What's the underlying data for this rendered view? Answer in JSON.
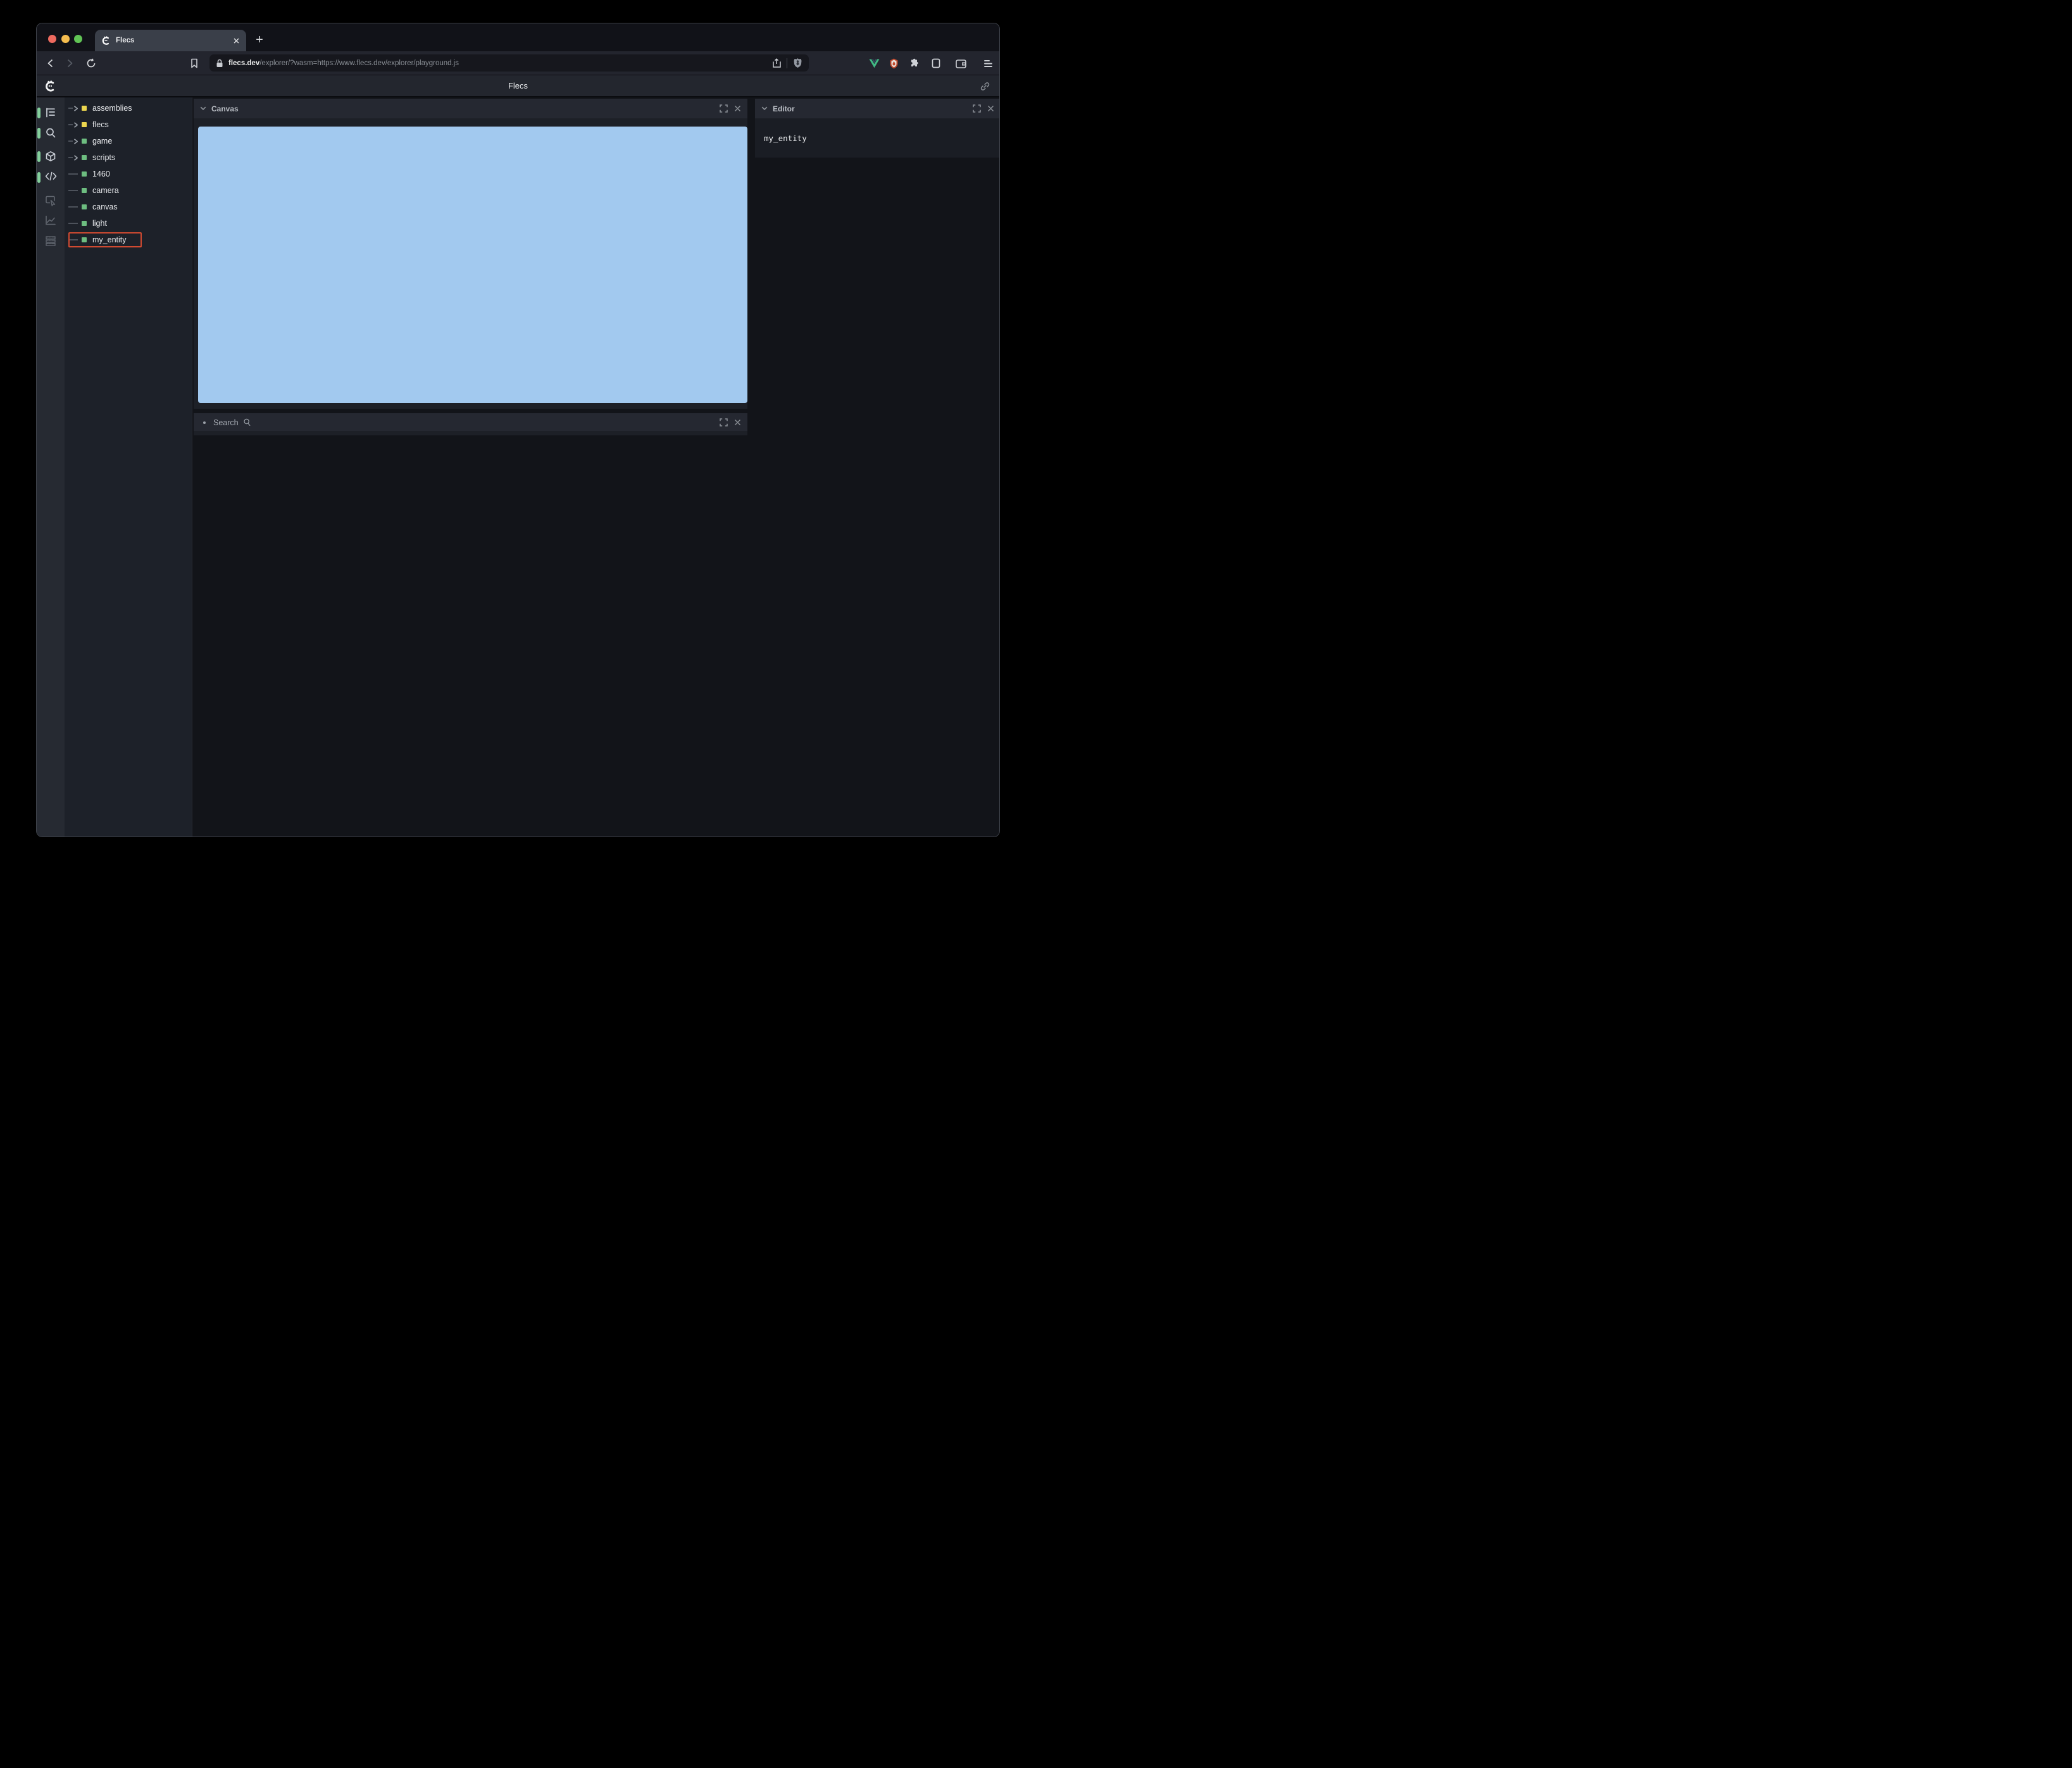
{
  "browser": {
    "tab": {
      "title": "Flecs",
      "close_label": "×",
      "favicon": "flecs-logo"
    },
    "new_tab_label": "+",
    "address": {
      "domain": "flecs.dev",
      "path": "/explorer/?wasm=https://www.flecs.dev/explorer/playground.js"
    },
    "toolbar_icons": [
      "back",
      "forward",
      "reload",
      "bookmark",
      "lock",
      "share",
      "brave-lion",
      "vue-devtools",
      "shield-extension",
      "extensions-puzzle",
      "sidebar",
      "wallet",
      "menu"
    ]
  },
  "app": {
    "header": {
      "title": "Flecs",
      "logo": "flecs-logo",
      "right_icon": "link"
    },
    "sidebar": {
      "active_color": "#83cf9b",
      "tools": [
        {
          "name": "hierarchy",
          "active": true
        },
        {
          "name": "search",
          "active": true
        },
        {
          "name": "entities-cube",
          "active": true
        },
        {
          "name": "code",
          "active": true
        },
        {
          "name": "inspect",
          "active": false
        },
        {
          "name": "stats-chart",
          "active": false
        },
        {
          "name": "memory",
          "active": false
        }
      ]
    },
    "tree": {
      "highlight_color": "#d04a31",
      "items": [
        {
          "label": "assemblies",
          "color": "#ecd64f",
          "expandable": true
        },
        {
          "label": "flecs",
          "color": "#ecd64f",
          "expandable": true
        },
        {
          "label": "game",
          "color": "#6dbd80",
          "expandable": true
        },
        {
          "label": "scripts",
          "color": "#6dbd80",
          "expandable": true
        },
        {
          "label": "1460",
          "color": "#6dbd80",
          "expandable": false
        },
        {
          "label": "camera",
          "color": "#6dbd80",
          "expandable": false
        },
        {
          "label": "canvas",
          "color": "#6dbd80",
          "expandable": false
        },
        {
          "label": "light",
          "color": "#6dbd80",
          "expandable": false
        },
        {
          "label": "my_entity",
          "color": "#6dbd80",
          "expandable": false,
          "highlighted": true
        }
      ]
    },
    "panels": {
      "canvas": {
        "title": "Canvas",
        "canvas_color": "#a2c9ef"
      },
      "search": {
        "title": "Search"
      },
      "editor": {
        "title": "Editor",
        "content": "my_entity"
      }
    }
  }
}
